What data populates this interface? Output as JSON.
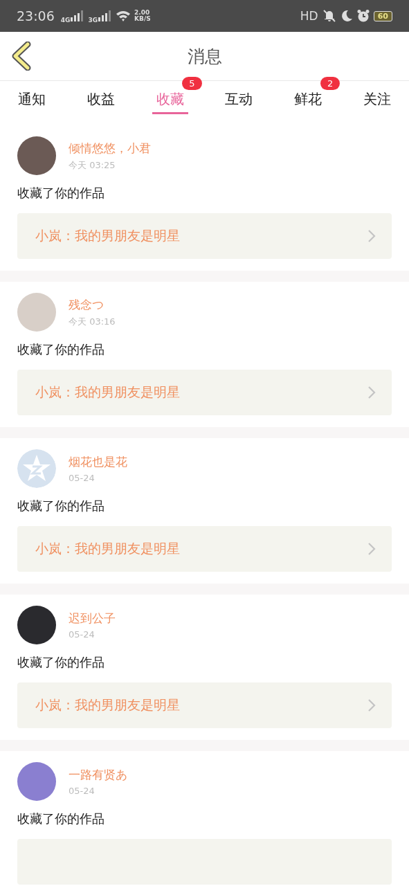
{
  "status_bar": {
    "time": "23:06",
    "net_1": "4G",
    "net_2": "3G",
    "speed": "2.00",
    "speed_unit": "KB/S",
    "hd": "HD",
    "battery": "60"
  },
  "header": {
    "title": "消息"
  },
  "tabs": [
    {
      "label": "通知",
      "selected": false
    },
    {
      "label": "收益",
      "selected": false
    },
    {
      "label": "收藏",
      "selected": true,
      "badge": "5"
    },
    {
      "label": "互动",
      "selected": false
    },
    {
      "label": "鲜花",
      "selected": false,
      "badge": "2"
    },
    {
      "label": "关注",
      "selected": false
    }
  ],
  "messages": [
    {
      "kind": "photo",
      "name": "倾情悠悠，小君",
      "time": "今天 03:25",
      "text": "收藏了你的作品",
      "work": "小岚：我的男朋友是明星"
    },
    {
      "kind": "photo",
      "name": "残念つ",
      "time": "今天 03:16",
      "text": "收藏了你的作品",
      "work": "小岚：我的男朋友是明星"
    },
    {
      "kind": "default",
      "name": "烟花也是花",
      "time": "05-24",
      "text": "收藏了你的作品",
      "work": "小岚：我的男朋友是明星"
    },
    {
      "kind": "photo",
      "name": "迟到公子",
      "time": "05-24",
      "text": "收藏了你的作品",
      "work": "小岚：我的男朋友是明星"
    },
    {
      "kind": "photo",
      "name": "一路有贤あ",
      "time": "05-24",
      "text": "收藏了你的作品"
    }
  ]
}
